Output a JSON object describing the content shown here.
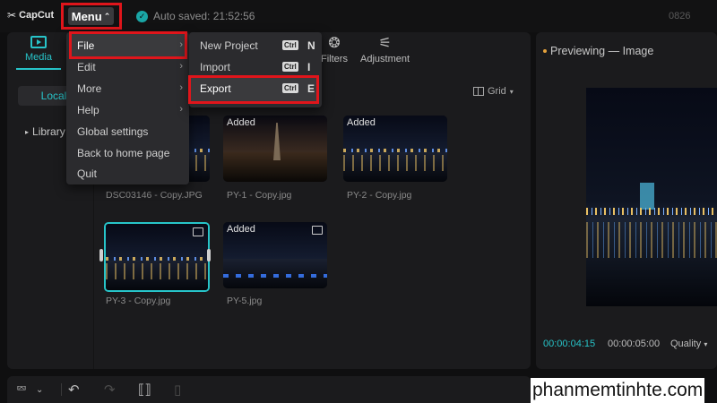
{
  "app": {
    "logo": "CapCut",
    "project_id": "0826"
  },
  "topbar": {
    "menu_label": "Menu",
    "autosave": "Auto saved: 21:52:56"
  },
  "tabs": [
    {
      "label": "Media"
    },
    {
      "label": "Filters"
    },
    {
      "label": "Adjustment"
    }
  ],
  "sidebar": {
    "local": "Local",
    "library": "Library"
  },
  "view": {
    "grid_label": "Grid"
  },
  "menu_items": [
    {
      "label": "File",
      "has_sub": true
    },
    {
      "label": "Edit",
      "has_sub": true
    },
    {
      "label": "More",
      "has_sub": true
    },
    {
      "label": "Help",
      "has_sub": true
    },
    {
      "label": "Global settings",
      "has_sub": false
    },
    {
      "label": "Back to home page",
      "has_sub": false
    },
    {
      "label": "Quit",
      "has_sub": false
    }
  ],
  "file_submenu": [
    {
      "label": "New Project",
      "kbd": "Ctrl",
      "key": "N"
    },
    {
      "label": "Import",
      "kbd": "Ctrl",
      "key": "I"
    },
    {
      "label": "Export",
      "kbd": "Ctrl",
      "key": "E"
    }
  ],
  "media": [
    {
      "caption": "DSC03146 - Copy.JPG",
      "badge": ""
    },
    {
      "caption": "PY-1 - Copy.jpg",
      "badge": "Added"
    },
    {
      "caption": "PY-2 - Copy.jpg",
      "badge": "Added"
    },
    {
      "caption": "PY-3 - Copy.jpg",
      "badge": ""
    },
    {
      "caption": "PY-5.jpg",
      "badge": "Added"
    }
  ],
  "preview": {
    "title": "Previewing — Image",
    "time_current": "00:00:04:15",
    "time_total": "00:00:05:00",
    "quality": "Quality"
  },
  "watermark": "phanmemtinhte.com",
  "colors": {
    "accent": "#27c4c9",
    "highlight": "#e0151b",
    "panel": "#1b1b1d"
  }
}
